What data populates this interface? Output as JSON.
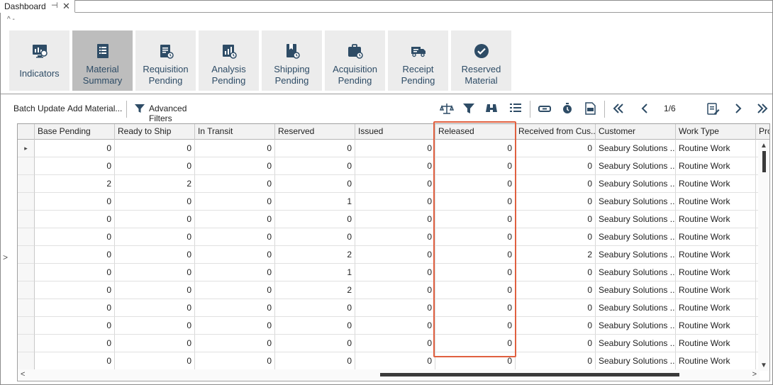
{
  "document_tab": {
    "title": "Dashboard",
    "pin_glyph": "⊣",
    "close_glyph": "✕"
  },
  "collapse_glyph": "^ -",
  "tiles": [
    {
      "label": "Indicators",
      "icon": "monitor-chart-icon",
      "active": false
    },
    {
      "label": "Material Summary",
      "icon": "document-list-icon",
      "active": true
    },
    {
      "label": "Requisition Pending",
      "icon": "clipboard-clock-icon",
      "active": false
    },
    {
      "label": "Analysis Pending",
      "icon": "chart-clock-icon",
      "active": false
    },
    {
      "label": "Shipping Pending",
      "icon": "bookmark-clock-icon",
      "active": false
    },
    {
      "label": "Acquisition Pending",
      "icon": "briefcase-clock-icon",
      "active": false
    },
    {
      "label": "Receipt Pending",
      "icon": "truck-icon",
      "active": false
    },
    {
      "label": "Reserved Material",
      "icon": "check-circle-icon",
      "active": false
    }
  ],
  "toolbar": {
    "batch_update": "Batch Update",
    "add_material": "Add Material...",
    "advanced_filters": "Advanced Filters",
    "page": "1/6"
  },
  "grid": {
    "columns": [
      "Base Pending",
      "Ready to Ship",
      "In Transit",
      "Reserved",
      "Issued",
      "Released",
      "Received from Cus...",
      "Customer",
      "Work Type",
      "Pro"
    ],
    "rows": [
      [
        "0",
        "0",
        "0",
        "0",
        "0",
        "0",
        "0",
        "Seabury Solutions ...",
        "Routine Work"
      ],
      [
        "0",
        "0",
        "0",
        "0",
        "0",
        "0",
        "0",
        "Seabury Solutions ...",
        "Routine Work"
      ],
      [
        "2",
        "2",
        "0",
        "0",
        "0",
        "0",
        "0",
        "Seabury Solutions ...",
        "Routine Work"
      ],
      [
        "0",
        "0",
        "0",
        "1",
        "0",
        "0",
        "0",
        "Seabury Solutions ...",
        "Routine Work"
      ],
      [
        "0",
        "0",
        "0",
        "0",
        "0",
        "0",
        "0",
        "Seabury Solutions ...",
        "Routine Work"
      ],
      [
        "0",
        "0",
        "0",
        "0",
        "0",
        "0",
        "0",
        "Seabury Solutions ...",
        "Routine Work"
      ],
      [
        "0",
        "0",
        "0",
        "2",
        "0",
        "0",
        "2",
        "Seabury Solutions ...",
        "Routine Work"
      ],
      [
        "0",
        "0",
        "0",
        "1",
        "0",
        "0",
        "0",
        "Seabury Solutions ...",
        "Routine Work"
      ],
      [
        "0",
        "0",
        "0",
        "2",
        "0",
        "0",
        "0",
        "Seabury Solutions ...",
        "Routine Work"
      ],
      [
        "0",
        "0",
        "0",
        "0",
        "0",
        "0",
        "0",
        "Seabury Solutions ...",
        "Routine Work"
      ],
      [
        "0",
        "0",
        "0",
        "0",
        "0",
        "0",
        "0",
        "Seabury Solutions ...",
        "Routine Work"
      ],
      [
        "0",
        "0",
        "0",
        "0",
        "0",
        "0",
        "0",
        "Seabury Solutions ...",
        "Routine Work"
      ],
      [
        "0",
        "0",
        "0",
        "0",
        "0",
        "0",
        "0",
        "Seabury Solutions ...",
        "Routine Work"
      ]
    ],
    "current_row_indicator": "▸",
    "highlighted_column": "Released"
  },
  "colors": {
    "tile_bg": "#ececec",
    "tile_active_bg": "#bdbdbd",
    "tile_label": "#2e4c66",
    "icon": "#2e4c66",
    "highlight": "#e06040"
  }
}
